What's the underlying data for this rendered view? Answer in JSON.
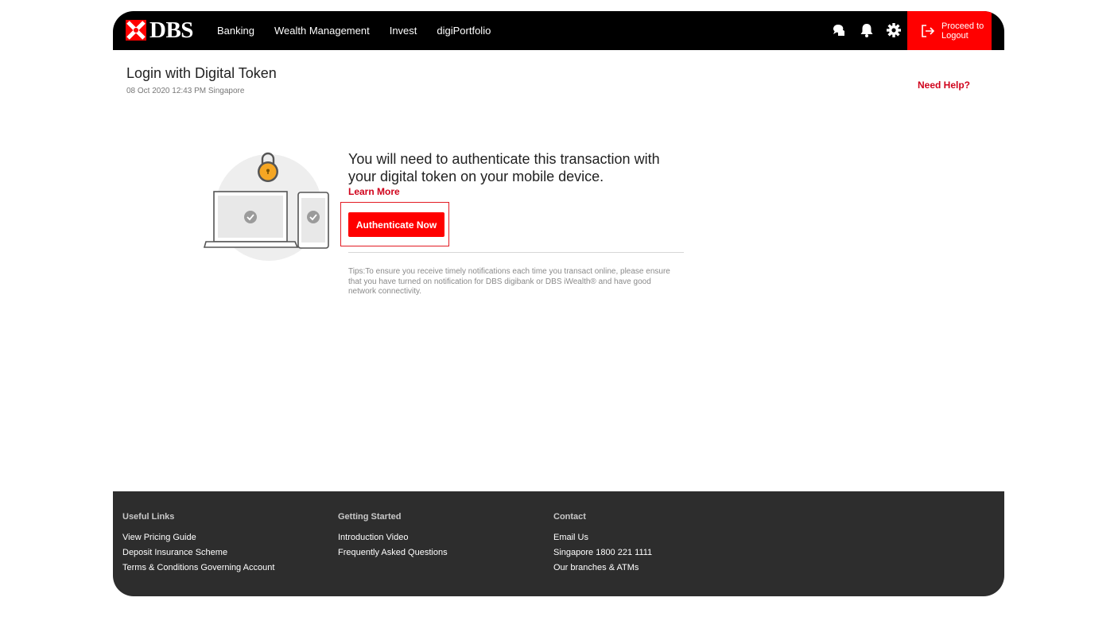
{
  "brand": {
    "name": "DBS",
    "accent": "#ff0000",
    "header_bg": "#000000",
    "footer_bg": "#2d2d2d"
  },
  "nav": {
    "items": [
      "Banking",
      "Wealth Management",
      "Invest",
      "digiPortfolio"
    ]
  },
  "header_icons": [
    "chat-icon",
    "bell-icon",
    "gear-icon"
  ],
  "logout": {
    "label": "Proceed to Logout"
  },
  "page": {
    "title": "Login with Digital Token",
    "timestamp": "08 Oct 2020 12:43 PM Singapore",
    "help_label": "Need Help?"
  },
  "auth": {
    "message": "You will need to authenticate this transaction with your digital token on your mobile device.",
    "learn_more": "Learn More",
    "button_label": "Authenticate Now",
    "tips": "Tips:To ensure you receive timely notifications each time you transact online, please ensure that you have turned on notification for DBS digibank or DBS iWealth® and have good network connectivity."
  },
  "footer": {
    "columns": [
      {
        "heading": "Useful Links",
        "links": [
          "View Pricing Guide",
          "Deposit Insurance Scheme",
          "Terms & Conditions Governing Account"
        ]
      },
      {
        "heading": "Getting Started",
        "links": [
          "Introduction Video",
          "Frequently Asked Questions"
        ]
      },
      {
        "heading": "Contact",
        "links": [
          "Email Us",
          "Singapore 1800 221 1111",
          "Our branches & ATMs"
        ]
      }
    ]
  }
}
